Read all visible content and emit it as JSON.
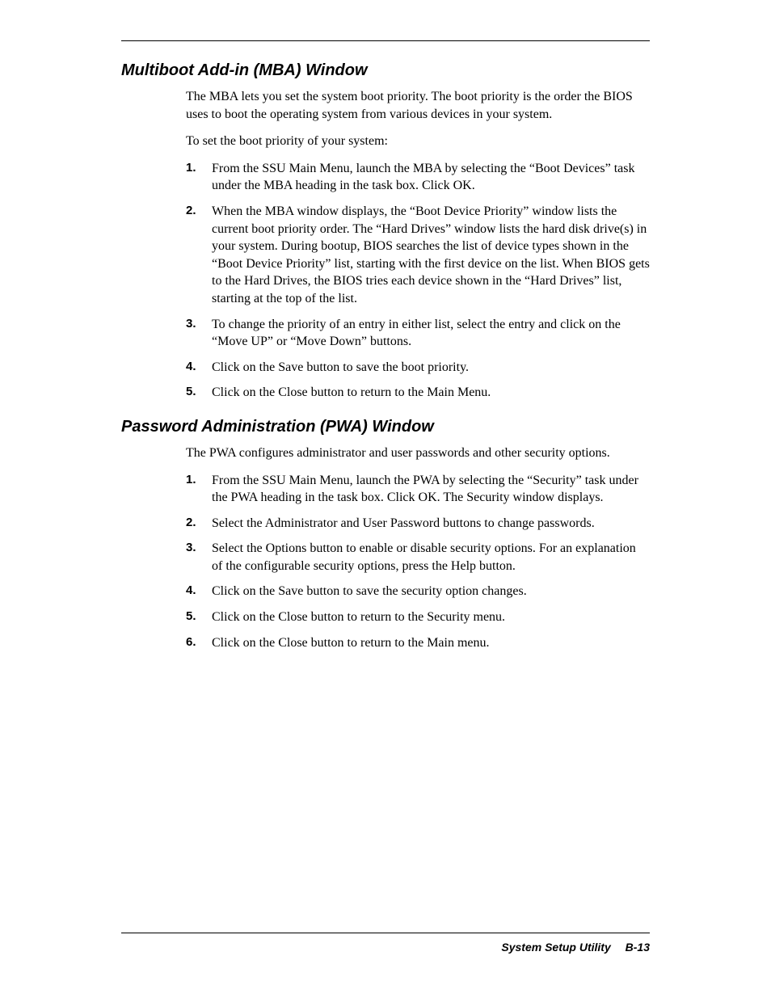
{
  "section1": {
    "heading": "Multiboot Add-in (MBA) Window",
    "para1": "The MBA lets you set the system boot priority. The boot priority is the order the BIOS uses to boot the operating system from various devices in your system.",
    "para2": "To set the boot priority of your system:",
    "list": [
      "From the SSU Main Menu, launch the MBA by selecting the “Boot Devices” task under the MBA heading in the task box. Click OK.",
      "When the MBA window displays, the “Boot Device Priority” window lists the current boot priority order. The “Hard Drives” window lists the hard disk drive(s) in your system. During bootup, BIOS searches the list of device types shown in the “Boot Device Priority” list, starting with the first device on the list. When BIOS gets to the Hard Drives, the BIOS tries each device shown in the “Hard Drives” list, starting at the top of the list.",
      "To change the priority of an entry in either list, select the entry and click on the “Move UP” or “Move Down” buttons.",
      "Click on the Save button to save the boot priority.",
      "Click on the Close button to return to the Main Menu."
    ]
  },
  "section2": {
    "heading": "Password Administration (PWA) Window",
    "para1": "The PWA configures administrator and user passwords and other security options.",
    "list": [
      "From the SSU Main Menu, launch the PWA by selecting the “Security” task under the PWA heading in the task box. Click OK. The Security window displays.",
      "Select the Administrator and User Password buttons to change passwords.",
      "Select the Options button to enable or disable security options. For an explanation of the configurable security options, press the Help button.",
      "Click on the Save button to save the security option changes.",
      "Click on the Close button to return to the Security menu.",
      "Click on the Close button to return to the Main menu."
    ]
  },
  "footer": {
    "title": "System Setup Utility",
    "page": "B-13"
  }
}
